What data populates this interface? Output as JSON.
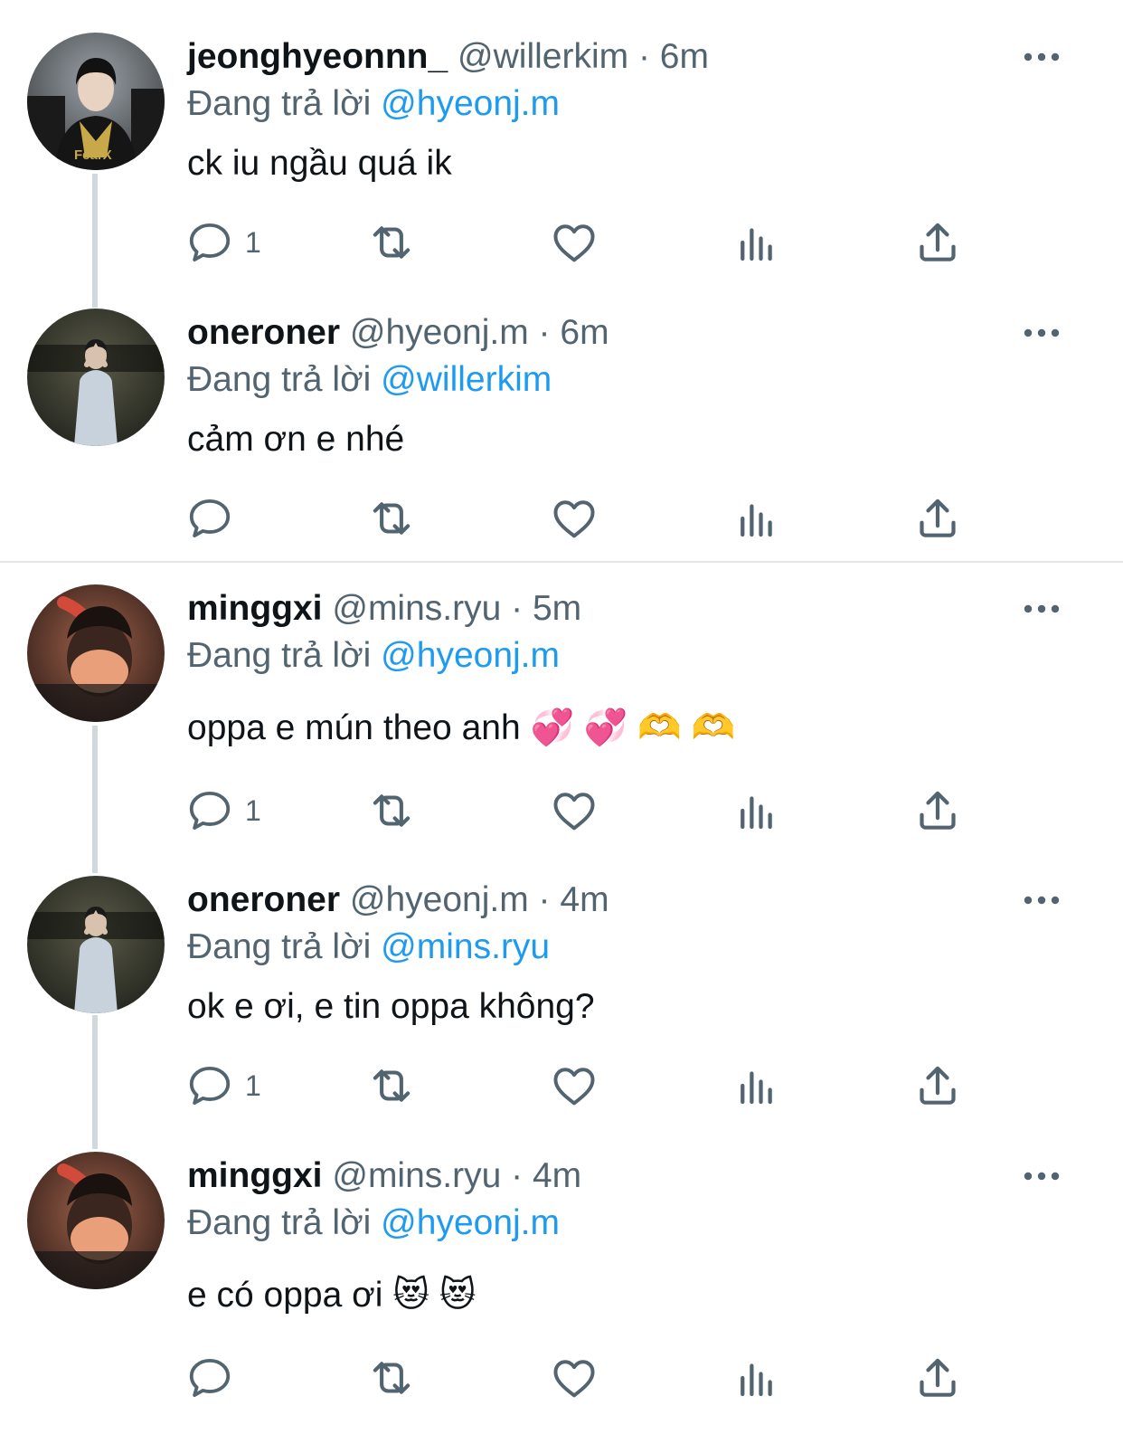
{
  "tweets": [
    {
      "name": "jeonghyeonnn_",
      "handle": "@willerkim",
      "time": "6m",
      "reply_prefix": "Đang trả lời",
      "reply_to": "@hyeonj.m",
      "text": "ck iu ngầu quá ik",
      "reply_count": "1",
      "avatar": "avatar-jersey-photo"
    },
    {
      "name": "oneroner",
      "handle": "@hyeonj.m",
      "time": "6m",
      "reply_prefix": "Đang trả lời",
      "reply_to": "@willerkim",
      "text": "cảm ơn e nhé",
      "reply_count": "",
      "avatar": "avatar-night-photo"
    },
    {
      "name": "minggxi",
      "handle": "@mins.ryu",
      "time": "5m",
      "reply_prefix": "Đang trả lời",
      "reply_to": "@hyeonj.m",
      "text": "oppa e mún theo anh 💞 💞 🫶 🫶",
      "reply_count": "1",
      "avatar": "avatar-mask-photo"
    },
    {
      "name": "oneroner",
      "handle": "@hyeonj.m",
      "time": "4m",
      "reply_prefix": "Đang trả lời",
      "reply_to": "@mins.ryu",
      "text": "ok e ơi, e tin oppa không?",
      "reply_count": "1",
      "avatar": "avatar-night-photo"
    },
    {
      "name": "minggxi",
      "handle": "@mins.ryu",
      "time": "4m",
      "reply_prefix": "Đang trả lời",
      "reply_to": "@hyeonj.m",
      "text": "e có oppa ơi 😻 😻",
      "reply_count": "",
      "avatar": "avatar-mask-photo"
    }
  ],
  "separator": " · ",
  "icons": [
    "reply-icon",
    "retweet-icon",
    "like-icon",
    "views-icon",
    "share-icon",
    "more-icon"
  ],
  "colors": {
    "accent": "#1d9bf0",
    "muted": "#536471",
    "text": "#0f1419",
    "thread_line": "#cfd9de"
  }
}
